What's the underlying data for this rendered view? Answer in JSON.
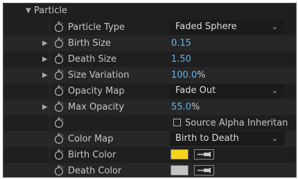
{
  "section": {
    "title": "Particle",
    "twirl": "▼"
  },
  "properties": {
    "particle_type": {
      "label": "Particle Type",
      "value": "Faded Sphere"
    },
    "birth_size": {
      "label": "Birth Size",
      "value": "0.15"
    },
    "death_size": {
      "label": "Death Size",
      "value": "1.50"
    },
    "size_variation": {
      "label": "Size Variation",
      "value": "100.0",
      "unit": "%"
    },
    "opacity_map": {
      "label": "Opacity Map",
      "value": "Fade Out"
    },
    "max_opacity": {
      "label": "Max Opacity",
      "value": "55.0",
      "unit": "%"
    },
    "source_alpha": {
      "label": "Source Alpha Inheritan",
      "checked": false
    },
    "color_map": {
      "label": "Color Map",
      "value": "Birth to Death"
    },
    "birth_color": {
      "label": "Birth Color",
      "color": "#f4d31a"
    },
    "death_color": {
      "label": "Death Color",
      "color": "#c4c4c4"
    }
  },
  "icons": {
    "twirl_collapsed": "▶",
    "chevron": "⌄"
  },
  "colors": {
    "panel_bg": "#1f1f1f",
    "value_blue": "#5cb8f0",
    "label_text": "#c7c7c7"
  }
}
